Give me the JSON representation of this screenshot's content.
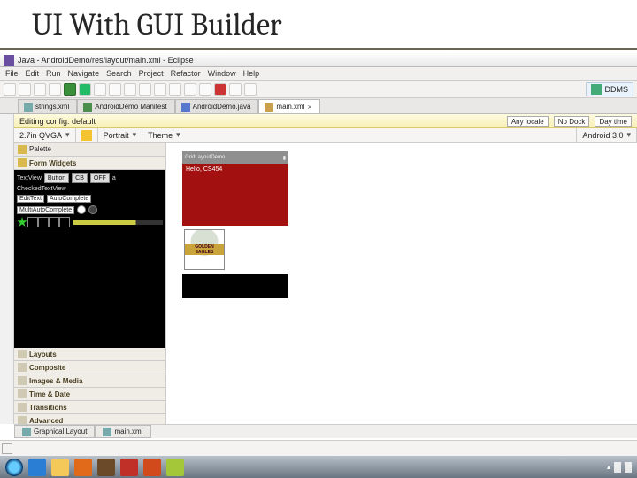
{
  "slide_title": "UI With GUI Builder",
  "window_title": "Java - AndroidDemo/res/layout/main.xml - Eclipse",
  "menu": [
    "File",
    "Edit",
    "Run",
    "Navigate",
    "Search",
    "Project",
    "Refactor",
    "Window",
    "Help"
  ],
  "perspective": {
    "label": "DDMS"
  },
  "tabs": [
    {
      "label": "strings.xml",
      "icon": "xml",
      "active": false
    },
    {
      "label": "AndroidDemo Manifest",
      "icon": "man",
      "active": false
    },
    {
      "label": "AndroidDemo.java",
      "icon": "java",
      "active": false
    },
    {
      "label": "main.xml",
      "icon": "axml",
      "active": true
    }
  ],
  "editbar": {
    "label": "Editing config: default",
    "options": [
      "Any locale",
      "No Dock",
      "Day time"
    ]
  },
  "config": {
    "device": "2.7in QVGA",
    "orientation": "Portrait",
    "theme_label": "Theme",
    "api": "Android 3.0"
  },
  "palette": {
    "title": "Palette",
    "form_widgets": "Form Widgets",
    "row1": {
      "textview": "TextView",
      "btn": "Button",
      "sm": "CB",
      "off": "OFF",
      "lbl": "a"
    },
    "row2": {
      "label": "CheckedTextView"
    },
    "row3": {
      "edit": "EditText",
      "ac": "AutoComplete"
    },
    "row4": {
      "mac": "MultiAutoComplete"
    },
    "drawers": [
      "Layouts",
      "Composite",
      "Images & Media",
      "Time & Date",
      "Transitions",
      "Advanced"
    ]
  },
  "device_preview": {
    "status": "GridLayoutDemo",
    "hello": "Hello, CS454"
  },
  "logo_text": "GOLDEN EAGLES",
  "bottom_tabs": [
    "Graphical Layout",
    "main.xml"
  ],
  "chart_data": null
}
